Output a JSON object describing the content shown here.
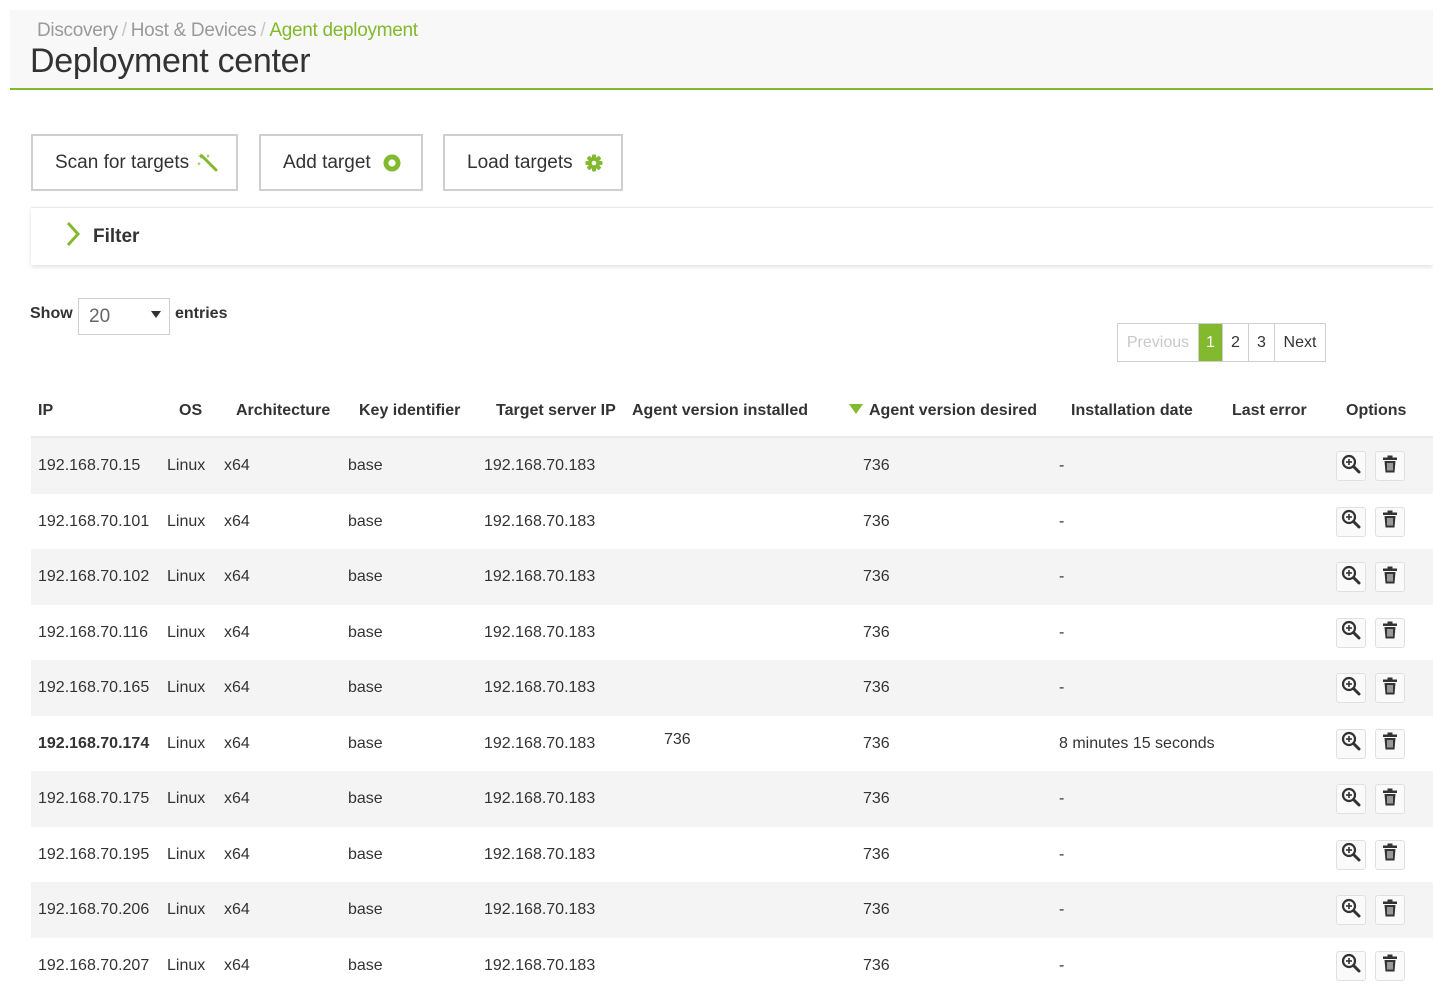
{
  "breadcrumb": [
    "Discovery",
    "Host & Devices",
    "Agent deployment"
  ],
  "page_title": "Deployment center",
  "toolbar": {
    "scan_label": "Scan for targets",
    "add_label": "Add target",
    "load_label": "Load targets"
  },
  "filter": {
    "label": "Filter"
  },
  "length_menu": {
    "show": "Show",
    "value": "20",
    "entries": "entries"
  },
  "pagination": {
    "previous": "Previous",
    "pages": [
      "1",
      "2",
      "3"
    ],
    "current": "1",
    "next": "Next"
  },
  "columns": [
    "IP",
    "OS",
    "Architecture",
    "Key identifier",
    "Target server IP",
    "Agent version installed",
    "Agent version desired",
    "Installation date",
    "Last error",
    "Options"
  ],
  "sorted_column": "Agent version desired",
  "rows": [
    {
      "ip": "192.168.70.15",
      "os": "Linux",
      "arch": "x64",
      "key": "base",
      "server": "192.168.70.183",
      "installed": "",
      "desired": "736",
      "date": "-",
      "error": ""
    },
    {
      "ip": "192.168.70.101",
      "os": "Linux",
      "arch": "x64",
      "key": "base",
      "server": "192.168.70.183",
      "installed": "",
      "desired": "736",
      "date": "-",
      "error": ""
    },
    {
      "ip": "192.168.70.102",
      "os": "Linux",
      "arch": "x64",
      "key": "base",
      "server": "192.168.70.183",
      "installed": "",
      "desired": "736",
      "date": "-",
      "error": ""
    },
    {
      "ip": "192.168.70.116",
      "os": "Linux",
      "arch": "x64",
      "key": "base",
      "server": "192.168.70.183",
      "installed": "",
      "desired": "736",
      "date": "-",
      "error": ""
    },
    {
      "ip": "192.168.70.165",
      "os": "Linux",
      "arch": "x64",
      "key": "base",
      "server": "192.168.70.183",
      "installed": "",
      "desired": "736",
      "date": "-",
      "error": ""
    },
    {
      "ip": "192.168.70.174",
      "os": "Linux",
      "arch": "x64",
      "key": "base",
      "server": "192.168.70.183",
      "installed": "736",
      "desired": "736",
      "date": "8 minutes 15 seconds",
      "error": "",
      "bold_ip": true
    },
    {
      "ip": "192.168.70.175",
      "os": "Linux",
      "arch": "x64",
      "key": "base",
      "server": "192.168.70.183",
      "installed": "",
      "desired": "736",
      "date": "-",
      "error": ""
    },
    {
      "ip": "192.168.70.195",
      "os": "Linux",
      "arch": "x64",
      "key": "base",
      "server": "192.168.70.183",
      "installed": "",
      "desired": "736",
      "date": "-",
      "error": ""
    },
    {
      "ip": "192.168.70.206",
      "os": "Linux",
      "arch": "x64",
      "key": "base",
      "server": "192.168.70.183",
      "installed": "",
      "desired": "736",
      "date": "-",
      "error": ""
    },
    {
      "ip": "192.168.70.207",
      "os": "Linux",
      "arch": "x64",
      "key": "base",
      "server": "192.168.70.183",
      "installed": "",
      "desired": "736",
      "date": "-",
      "error": ""
    }
  ],
  "row_options": [
    "magnifier-icon",
    "trash-icon"
  ],
  "colors": {
    "accent": "#82b92e",
    "row_alt": "#f4f4f4",
    "border": "#cfcfcf"
  }
}
